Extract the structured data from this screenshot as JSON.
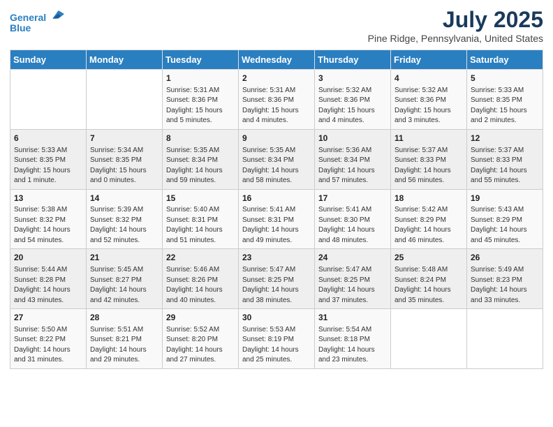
{
  "logo": {
    "line1": "General",
    "line2": "Blue"
  },
  "title": "July 2025",
  "subtitle": "Pine Ridge, Pennsylvania, United States",
  "days_of_week": [
    "Sunday",
    "Monday",
    "Tuesday",
    "Wednesday",
    "Thursday",
    "Friday",
    "Saturday"
  ],
  "weeks": [
    [
      {
        "day": "",
        "info": ""
      },
      {
        "day": "",
        "info": ""
      },
      {
        "day": "1",
        "info": "Sunrise: 5:31 AM\nSunset: 8:36 PM\nDaylight: 15 hours\nand 5 minutes."
      },
      {
        "day": "2",
        "info": "Sunrise: 5:31 AM\nSunset: 8:36 PM\nDaylight: 15 hours\nand 4 minutes."
      },
      {
        "day": "3",
        "info": "Sunrise: 5:32 AM\nSunset: 8:36 PM\nDaylight: 15 hours\nand 4 minutes."
      },
      {
        "day": "4",
        "info": "Sunrise: 5:32 AM\nSunset: 8:36 PM\nDaylight: 15 hours\nand 3 minutes."
      },
      {
        "day": "5",
        "info": "Sunrise: 5:33 AM\nSunset: 8:35 PM\nDaylight: 15 hours\nand 2 minutes."
      }
    ],
    [
      {
        "day": "6",
        "info": "Sunrise: 5:33 AM\nSunset: 8:35 PM\nDaylight: 15 hours\nand 1 minute."
      },
      {
        "day": "7",
        "info": "Sunrise: 5:34 AM\nSunset: 8:35 PM\nDaylight: 15 hours\nand 0 minutes."
      },
      {
        "day": "8",
        "info": "Sunrise: 5:35 AM\nSunset: 8:34 PM\nDaylight: 14 hours\nand 59 minutes."
      },
      {
        "day": "9",
        "info": "Sunrise: 5:35 AM\nSunset: 8:34 PM\nDaylight: 14 hours\nand 58 minutes."
      },
      {
        "day": "10",
        "info": "Sunrise: 5:36 AM\nSunset: 8:34 PM\nDaylight: 14 hours\nand 57 minutes."
      },
      {
        "day": "11",
        "info": "Sunrise: 5:37 AM\nSunset: 8:33 PM\nDaylight: 14 hours\nand 56 minutes."
      },
      {
        "day": "12",
        "info": "Sunrise: 5:37 AM\nSunset: 8:33 PM\nDaylight: 14 hours\nand 55 minutes."
      }
    ],
    [
      {
        "day": "13",
        "info": "Sunrise: 5:38 AM\nSunset: 8:32 PM\nDaylight: 14 hours\nand 54 minutes."
      },
      {
        "day": "14",
        "info": "Sunrise: 5:39 AM\nSunset: 8:32 PM\nDaylight: 14 hours\nand 52 minutes."
      },
      {
        "day": "15",
        "info": "Sunrise: 5:40 AM\nSunset: 8:31 PM\nDaylight: 14 hours\nand 51 minutes."
      },
      {
        "day": "16",
        "info": "Sunrise: 5:41 AM\nSunset: 8:31 PM\nDaylight: 14 hours\nand 49 minutes."
      },
      {
        "day": "17",
        "info": "Sunrise: 5:41 AM\nSunset: 8:30 PM\nDaylight: 14 hours\nand 48 minutes."
      },
      {
        "day": "18",
        "info": "Sunrise: 5:42 AM\nSunset: 8:29 PM\nDaylight: 14 hours\nand 46 minutes."
      },
      {
        "day": "19",
        "info": "Sunrise: 5:43 AM\nSunset: 8:29 PM\nDaylight: 14 hours\nand 45 minutes."
      }
    ],
    [
      {
        "day": "20",
        "info": "Sunrise: 5:44 AM\nSunset: 8:28 PM\nDaylight: 14 hours\nand 43 minutes."
      },
      {
        "day": "21",
        "info": "Sunrise: 5:45 AM\nSunset: 8:27 PM\nDaylight: 14 hours\nand 42 minutes."
      },
      {
        "day": "22",
        "info": "Sunrise: 5:46 AM\nSunset: 8:26 PM\nDaylight: 14 hours\nand 40 minutes."
      },
      {
        "day": "23",
        "info": "Sunrise: 5:47 AM\nSunset: 8:25 PM\nDaylight: 14 hours\nand 38 minutes."
      },
      {
        "day": "24",
        "info": "Sunrise: 5:47 AM\nSunset: 8:25 PM\nDaylight: 14 hours\nand 37 minutes."
      },
      {
        "day": "25",
        "info": "Sunrise: 5:48 AM\nSunset: 8:24 PM\nDaylight: 14 hours\nand 35 minutes."
      },
      {
        "day": "26",
        "info": "Sunrise: 5:49 AM\nSunset: 8:23 PM\nDaylight: 14 hours\nand 33 minutes."
      }
    ],
    [
      {
        "day": "27",
        "info": "Sunrise: 5:50 AM\nSunset: 8:22 PM\nDaylight: 14 hours\nand 31 minutes."
      },
      {
        "day": "28",
        "info": "Sunrise: 5:51 AM\nSunset: 8:21 PM\nDaylight: 14 hours\nand 29 minutes."
      },
      {
        "day": "29",
        "info": "Sunrise: 5:52 AM\nSunset: 8:20 PM\nDaylight: 14 hours\nand 27 minutes."
      },
      {
        "day": "30",
        "info": "Sunrise: 5:53 AM\nSunset: 8:19 PM\nDaylight: 14 hours\nand 25 minutes."
      },
      {
        "day": "31",
        "info": "Sunrise: 5:54 AM\nSunset: 8:18 PM\nDaylight: 14 hours\nand 23 minutes."
      },
      {
        "day": "",
        "info": ""
      },
      {
        "day": "",
        "info": ""
      }
    ]
  ]
}
